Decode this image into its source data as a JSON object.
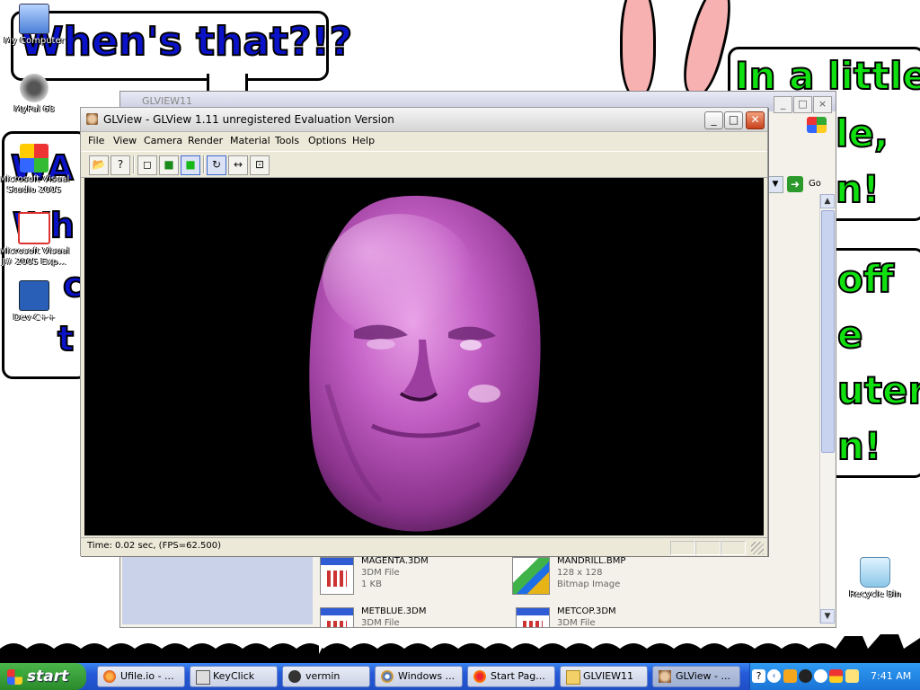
{
  "desktop": {
    "bubbles": [
      {
        "text": "When's that?!?",
        "color": "#0b13c9"
      },
      {
        "text": "In a little",
        "color": "#10e010"
      },
      {
        "text": "le,",
        "color": "#10e010"
      },
      {
        "text": "n!",
        "color": "#10e010"
      },
      {
        "text": "off",
        "color": "#10e010"
      },
      {
        "text": "e",
        "color": "#10e010"
      },
      {
        "text": "uter,",
        "color": "#10e010"
      },
      {
        "text": "n!",
        "color": "#10e010"
      },
      {
        "text": "WA",
        "color": "#0b13c9"
      },
      {
        "text": "Wh",
        "color": "#0b13c9"
      },
      {
        "text": "c",
        "color": "#0b13c9"
      },
      {
        "text": "t",
        "color": "#0b13c9"
      }
    ],
    "icons": [
      {
        "label": "My Computer",
        "icon": "computer-icon"
      },
      {
        "label": "MyPal 68",
        "icon": "mypal-icon"
      },
      {
        "label": "Microsoft Visual Studio 2005",
        "icon": "visual-studio-icon"
      },
      {
        "label": "Microsoft Visual J# 2005 Exp...",
        "icon": "vj-sharp-icon"
      },
      {
        "label": "Dev-C++",
        "icon": "dev-cpp-icon"
      },
      {
        "label": "Recycle Bin",
        "icon": "recycle-bin-icon"
      }
    ]
  },
  "explorer": {
    "title": "GLVIEW11",
    "go_label": "Go",
    "files": [
      {
        "name": "MAGENTA.3DM",
        "type": "3DM File",
        "size": "1 KB"
      },
      {
        "name": "MANDRILL.BMP",
        "type": "128 x 128",
        "size": "Bitmap Image"
      },
      {
        "name": "METBLUE.3DM",
        "type": "3DM File",
        "size": ""
      },
      {
        "name": "METCOP.3DM",
        "type": "3DM File",
        "size": ""
      }
    ]
  },
  "glview": {
    "title": "GLView - GLView 1.11 unregistered Evaluation Version",
    "menus": [
      "File",
      "View",
      "Camera",
      "Render",
      "Material",
      "Tools",
      "Options",
      "Help"
    ],
    "status": "Time: 0.02 sec, (FPS=62.500)",
    "model_color": "#c25ec4"
  },
  "taskbar": {
    "start_label": "start",
    "tasks": [
      {
        "label": "Ufile.io - ...",
        "icon": "firefox-icon"
      },
      {
        "label": "KeyClick",
        "icon": "keyboard-icon"
      },
      {
        "label": "vermin",
        "icon": "bug-icon"
      },
      {
        "label": "Windows ...",
        "icon": "media-player-icon"
      },
      {
        "label": "Start Pag...",
        "icon": "browser-icon"
      },
      {
        "label": "GLVIEW11",
        "icon": "folder-icon"
      },
      {
        "label": "GLView - ...",
        "icon": "glview-icon"
      }
    ],
    "clock": "7:41 AM"
  },
  "colors": {
    "taskbar_blue": "#2459d8",
    "start_green": "#2a8a2a",
    "bubble_blue": "#0b13c9",
    "bubble_green": "#10e010"
  }
}
